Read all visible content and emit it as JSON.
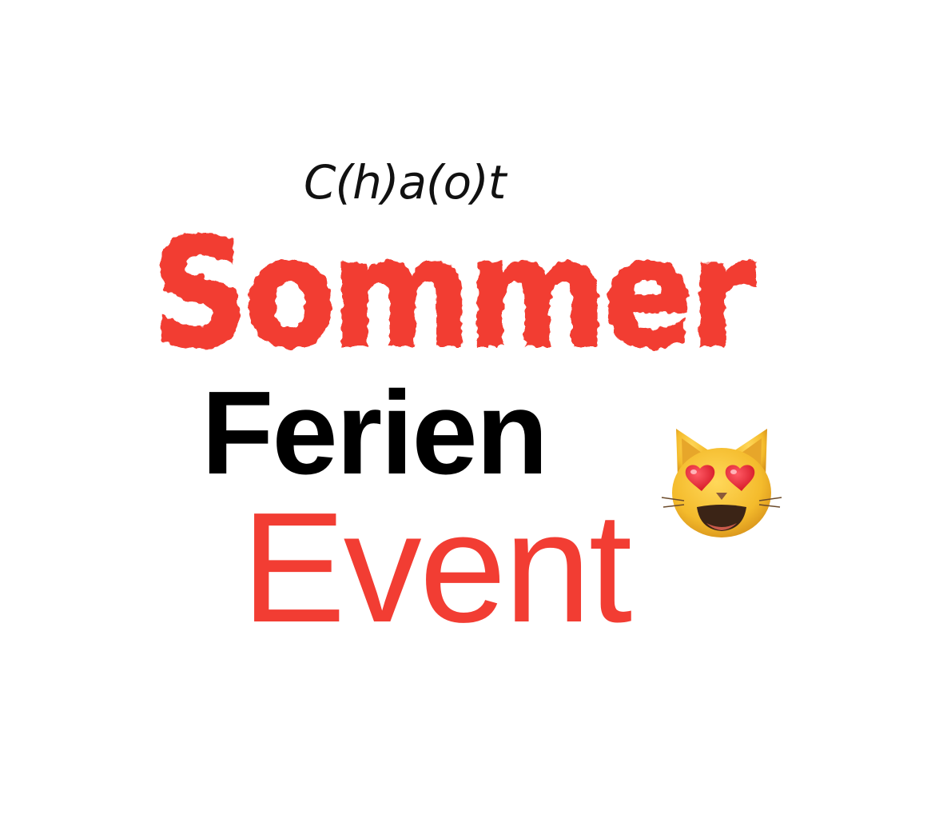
{
  "poster": {
    "brand": "C(h)a(o)t",
    "headline_1": "Sommer",
    "headline_2": "Ferien",
    "headline_3": "Event",
    "emoji": "smiling-cat-with-heart-eyes-icon"
  },
  "colors": {
    "accent_red": "#f23d33",
    "text_dark": "#000000",
    "emoji_yellow": "#f6c232",
    "heart_red": "#e8232f"
  }
}
